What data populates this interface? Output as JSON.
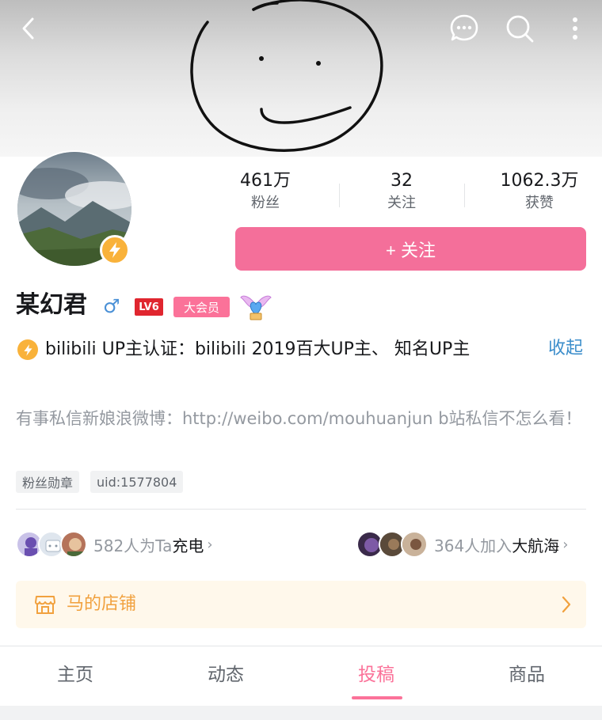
{
  "topbar": {
    "back_icon": "chevron-left-icon",
    "message_icon": "chat-bubble-icon",
    "search_icon": "search-icon",
    "more_icon": "vertical-dots-icon"
  },
  "banner": {
    "image": "smiley-face-drawing"
  },
  "profile": {
    "avatar": "landscape-mountain-photo",
    "verify_badge_icon": "lightning-icon",
    "name": "某幻君",
    "gender_symbol": "♂",
    "level_badge": "LV6",
    "vip_badge": "大会员",
    "pendant_icon": "winged-heart-pendant-icon"
  },
  "stats": [
    {
      "value": "461万",
      "label": "粉丝"
    },
    {
      "value": "32",
      "label": "关注"
    },
    {
      "value": "1062.3万",
      "label": "获赞"
    }
  ],
  "follow_button": {
    "label": "+ 关注"
  },
  "certification": {
    "text": "bilibili  UP主认证：bilibili  2019百大UP主、 知名UP主",
    "collapse_label": "收起"
  },
  "bio": "有事私信新娘浪微博：http://weibo.com/mouhuanjun  b站私信不怎么看！",
  "tags": [
    {
      "label": "粉丝勋章"
    },
    {
      "label": "uid:1577804"
    }
  ],
  "charge": {
    "count_text": "582人为Ta",
    "strong_text": "充电",
    "chevron": "›"
  },
  "guard": {
    "count_text": "364人加入",
    "strong_text": "大航海",
    "chevron": "›"
  },
  "shop": {
    "label": "马的店铺"
  },
  "tabs": [
    {
      "label": "主页"
    },
    {
      "label": "动态"
    },
    {
      "label": "投稿"
    },
    {
      "label": "商品"
    }
  ],
  "active_tab": "投稿",
  "colors": {
    "accent_pink": "#fb7299",
    "follow_pink": "#f46f9a",
    "link_blue": "#3c8ecb",
    "shop_orange": "#f1a13e",
    "badge_yellow": "#f9b23a"
  }
}
